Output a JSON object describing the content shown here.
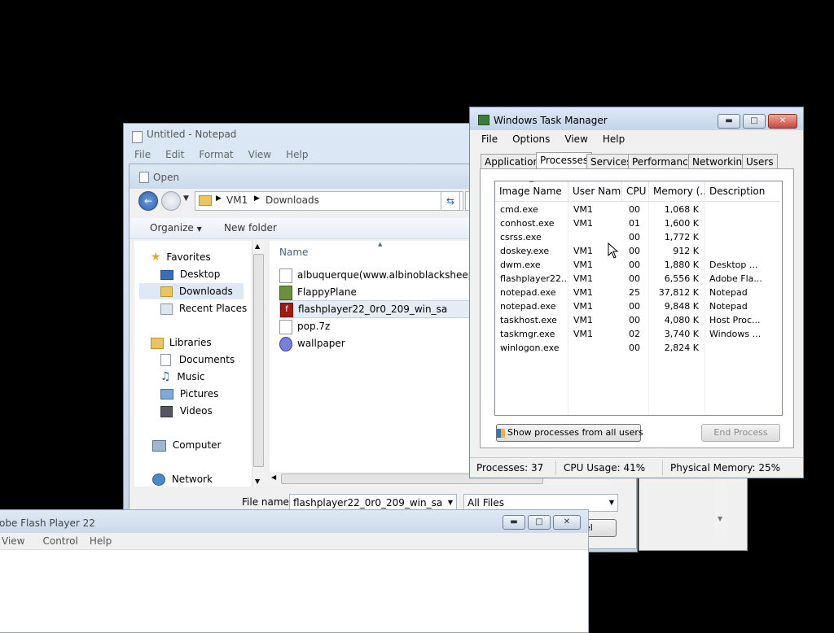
{
  "notepad": {
    "title": "Untitled - Notepad",
    "menu": [
      "File",
      "Edit",
      "Format",
      "View",
      "Help"
    ]
  },
  "open_dialog": {
    "title": "Open",
    "breadcrumb": [
      "VM1",
      "Downloads"
    ],
    "toolbar": {
      "organize": "Organize",
      "new_folder": "New folder"
    },
    "nav": {
      "favorites": "Favorites",
      "desktop": "Desktop",
      "downloads": "Downloads",
      "recent": "Recent Places",
      "libraries": "Libraries",
      "documents": "Documents",
      "music": "Music",
      "pictures": "Pictures",
      "videos": "Videos",
      "computer": "Computer",
      "network": "Network"
    },
    "column_name": "Name",
    "files": [
      "albuquerque(www.albinoblacksheep.co",
      "FlappyPlane",
      "flashplayer22_0r0_209_win_sa",
      "pop.7z",
      "wallpaper"
    ],
    "file_name_label": "File name:",
    "file_name_value": "flashplayer22_0r0_209_win_sa",
    "file_type": "All Files",
    "cancel_fragment": "el"
  },
  "flash_player": {
    "title": "obe Flash Player 22",
    "menu": [
      "View",
      "Control",
      "Help"
    ]
  },
  "task_manager": {
    "title": "Windows Task Manager",
    "menu": [
      "File",
      "Options",
      "View",
      "Help"
    ],
    "tabs": [
      "Applications",
      "Processes",
      "Services",
      "Performance",
      "Networking",
      "Users"
    ],
    "active_tab": "Processes",
    "columns": [
      "Image Name",
      "User Name",
      "CPU",
      "Memory (...",
      "Description"
    ],
    "processes": [
      {
        "name": "cmd.exe",
        "user": "VM1",
        "cpu": "00",
        "mem": "1,068 K",
        "desc": ""
      },
      {
        "name": "conhost.exe",
        "user": "VM1",
        "cpu": "01",
        "mem": "1,600 K",
        "desc": ""
      },
      {
        "name": "csrss.exe",
        "user": "",
        "cpu": "00",
        "mem": "1,772 K",
        "desc": ""
      },
      {
        "name": "doskey.exe",
        "user": "VM1",
        "cpu": "00",
        "mem": "912 K",
        "desc": ""
      },
      {
        "name": "dwm.exe",
        "user": "VM1",
        "cpu": "00",
        "mem": "1,880 K",
        "desc": "Desktop ..."
      },
      {
        "name": "flashplayer22...",
        "user": "VM1",
        "cpu": "00",
        "mem": "6,556 K",
        "desc": "Adobe Fla..."
      },
      {
        "name": "notepad.exe",
        "user": "VM1",
        "cpu": "25",
        "mem": "37,812 K",
        "desc": "Notepad"
      },
      {
        "name": "notepad.exe",
        "user": "VM1",
        "cpu": "00",
        "mem": "9,848 K",
        "desc": "Notepad"
      },
      {
        "name": "taskhost.exe",
        "user": "VM1",
        "cpu": "00",
        "mem": "4,080 K",
        "desc": "Host Proc..."
      },
      {
        "name": "taskmgr.exe",
        "user": "VM1",
        "cpu": "02",
        "mem": "3,740 K",
        "desc": "Windows ..."
      },
      {
        "name": "winlogon.exe",
        "user": "",
        "cpu": "00",
        "mem": "2,824 K",
        "desc": ""
      }
    ],
    "show_all_button": "Show processes from all users",
    "end_process_button": "End Process",
    "status": {
      "processes": "Processes: 37",
      "cpu": "CPU Usage: 41%",
      "memory": "Physical Memory: 25%"
    }
  }
}
